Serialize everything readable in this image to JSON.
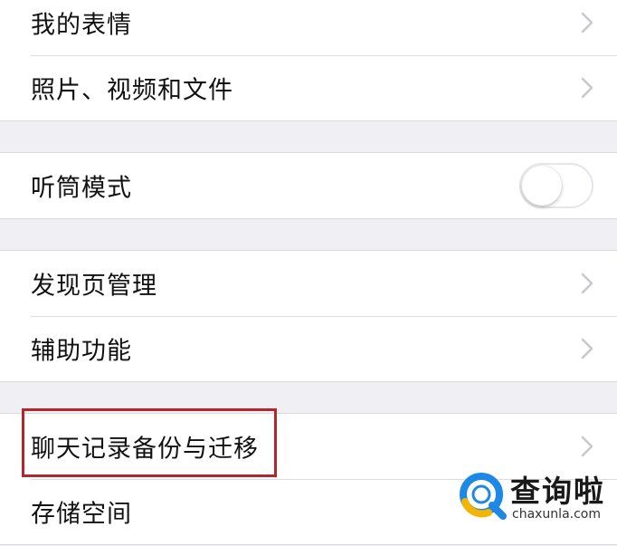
{
  "sections": [
    {
      "items": [
        {
          "label": "我的表情"
        },
        {
          "label": "照片、视频和文件"
        }
      ]
    },
    {
      "items": [
        {
          "label": "听筒模式",
          "toggle_on": false
        }
      ]
    },
    {
      "items": [
        {
          "label": "发现页管理"
        },
        {
          "label": "辅助功能"
        }
      ]
    },
    {
      "items": [
        {
          "label": "聊天记录备份与迁移"
        },
        {
          "label": "存储空间"
        }
      ]
    }
  ],
  "highlight_color": "#b3262b",
  "watermark": {
    "title": "查询啦",
    "url": "chaxunla.com"
  },
  "colors": {
    "background": "#efeff4",
    "row_background": "#ffffff",
    "chevron": "#c7c7cc",
    "logo_blue": "#1e88e5",
    "logo_yellow": "#f5b400"
  }
}
